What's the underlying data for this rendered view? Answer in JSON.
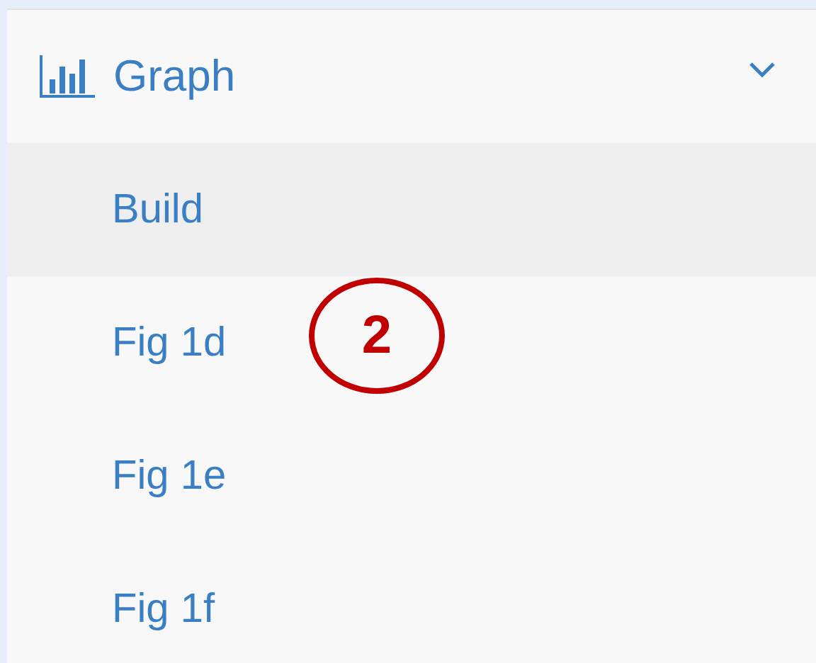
{
  "menu": {
    "label": "Graph",
    "expanded": true,
    "items": [
      {
        "label": "Build",
        "selected": true
      },
      {
        "label": "Fig 1d",
        "selected": false
      },
      {
        "label": "Fig 1e",
        "selected": false
      },
      {
        "label": "Fig 1f",
        "selected": false
      }
    ]
  },
  "callout": {
    "label": "2"
  }
}
